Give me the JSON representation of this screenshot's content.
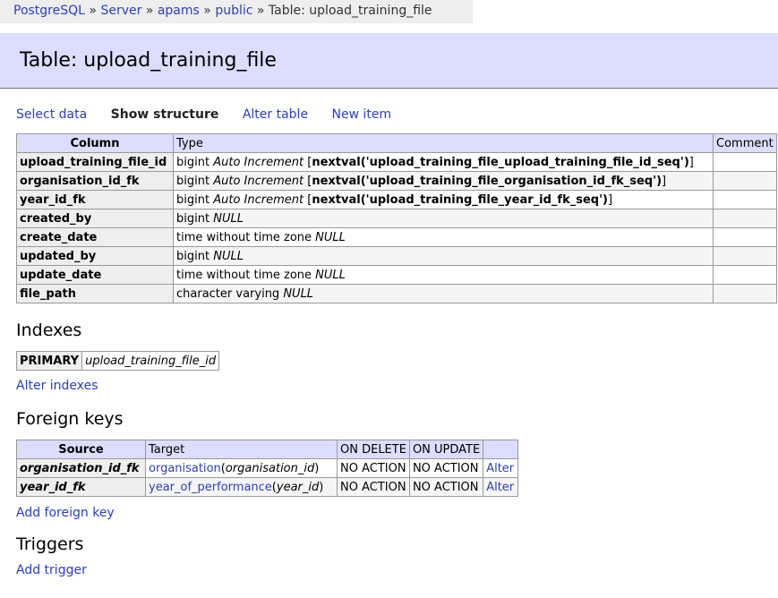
{
  "breadcrumb": {
    "items": [
      "PostgreSQL",
      "Server",
      "apams",
      "public"
    ],
    "separator": "»",
    "current": "Table: upload_training_file"
  },
  "page": {
    "title": "Table: upload_training_file"
  },
  "nav": {
    "select_data": "Select data",
    "show_structure": "Show structure",
    "alter_table": "Alter table",
    "new_item": "New item"
  },
  "columns_table": {
    "headers": [
      "Column",
      "Type",
      "Comment"
    ],
    "rows": [
      {
        "name": "upload_training_file_id",
        "type": "bigint",
        "attr": "Auto Increment",
        "default": "nextval('upload_training_file_upload_training_file_id_seq')"
      },
      {
        "name": "organisation_id_fk",
        "type": "bigint",
        "attr": "Auto Increment",
        "default": "nextval('upload_training_file_organisation_id_fk_seq')"
      },
      {
        "name": "year_id_fk",
        "type": "bigint",
        "attr": "Auto Increment",
        "default": "nextval('upload_training_file_year_id_fk_seq')"
      },
      {
        "name": "created_by",
        "type": "bigint",
        "attr": "NULL",
        "default": ""
      },
      {
        "name": "create_date",
        "type": "time without time zone",
        "attr": "NULL",
        "default": ""
      },
      {
        "name": "updated_by",
        "type": "bigint",
        "attr": "NULL",
        "default": ""
      },
      {
        "name": "update_date",
        "type": "time without time zone",
        "attr": "NULL",
        "default": ""
      },
      {
        "name": "file_path",
        "type": "character varying",
        "attr": "NULL",
        "default": ""
      }
    ]
  },
  "indexes": {
    "heading": "Indexes",
    "items": [
      {
        "type": "PRIMARY",
        "columns": "upload_training_file_id"
      }
    ],
    "alter_link": "Alter indexes"
  },
  "foreign_keys": {
    "heading": "Foreign keys",
    "headers": [
      "Source",
      "Target",
      "ON DELETE",
      "ON UPDATE"
    ],
    "rows": [
      {
        "source": "organisation_id_fk",
        "target_table": "organisation",
        "target_col": "organisation_id",
        "on_delete": "NO ACTION",
        "on_update": "NO ACTION",
        "action": "Alter"
      },
      {
        "source": "year_id_fk",
        "target_table": "year_of_performance",
        "target_col": "year_id",
        "on_delete": "NO ACTION",
        "on_update": "NO ACTION",
        "action": "Alter"
      }
    ],
    "add_link": "Add foreign key"
  },
  "triggers": {
    "heading": "Triggers",
    "add_link": "Add trigger"
  }
}
